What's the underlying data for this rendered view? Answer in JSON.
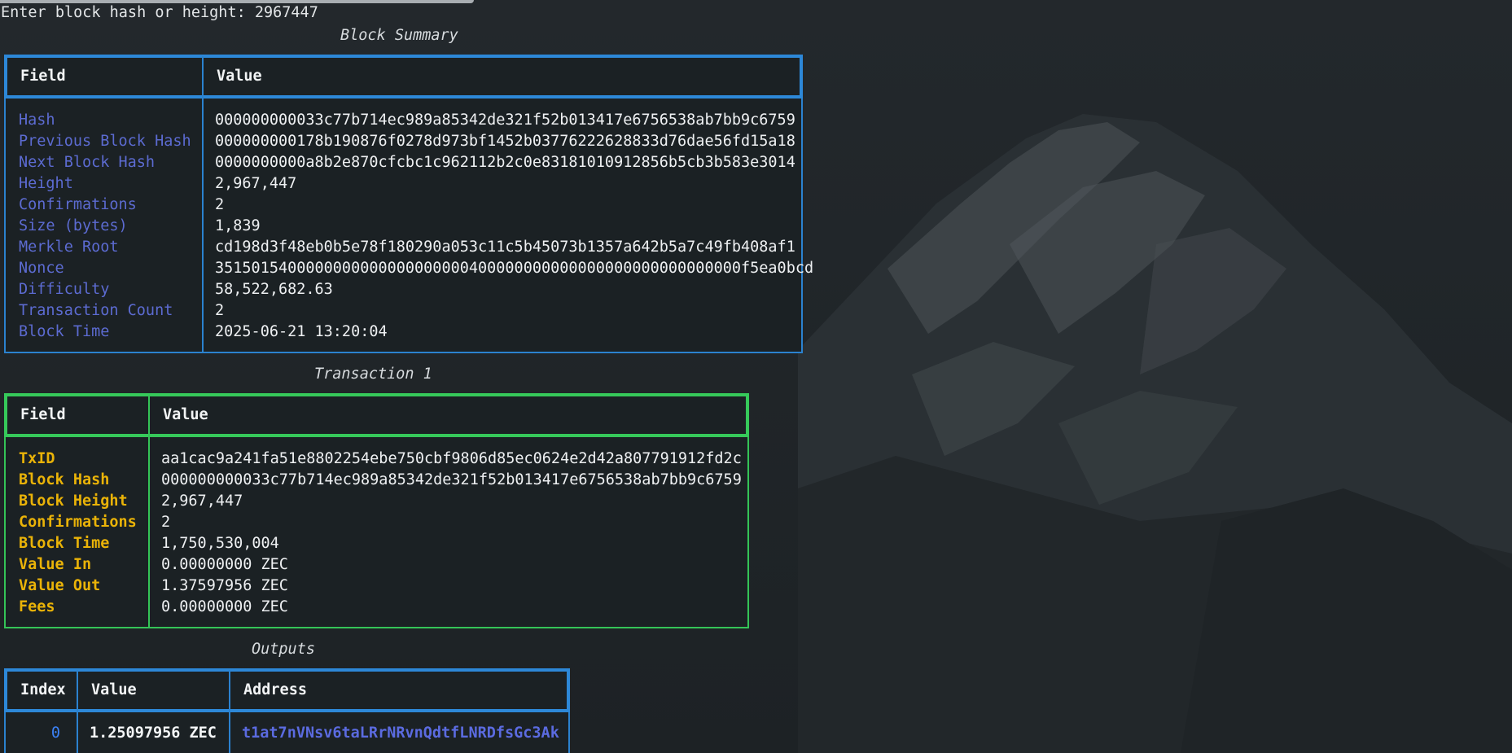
{
  "prompt": "Enter block hash or height: 2967447",
  "block_summary": {
    "caption": "Block Summary",
    "headers": [
      "Field",
      "Value"
    ],
    "rows": [
      {
        "field": "Hash",
        "value": "000000000033c77b714ec989a85342de321f52b013417e6756538ab7bb9c6759"
      },
      {
        "field": "Previous Block Hash",
        "value": "000000000178b190876f0278d973bf1452b03776222628833d76dae56fd15a18"
      },
      {
        "field": "Next Block Hash",
        "value": "0000000000a8b2e870cfcbc1c962112b2c0e83181010912856b5cb3b583e3014"
      },
      {
        "field": "Height",
        "value": "2,967,447"
      },
      {
        "field": "Confirmations",
        "value": "2"
      },
      {
        "field": "Size (bytes)",
        "value": "1,839"
      },
      {
        "field": "Merkle Root",
        "value": "cd198d3f48eb0b5e78f180290a053c11c5b45073b1357a642b5a7c49fb408af1"
      },
      {
        "field": "Nonce",
        "value": "3515015400000000000000000000400000000000000000000000000000f5ea0bcd"
      },
      {
        "field": "Difficulty",
        "value": "58,522,682.63"
      },
      {
        "field": "Transaction Count",
        "value": "2"
      },
      {
        "field": "Block Time",
        "value": "2025-06-21 13:20:04"
      }
    ]
  },
  "transaction": {
    "caption": "Transaction 1",
    "headers": [
      "Field",
      "Value"
    ],
    "rows": [
      {
        "field": "TxID",
        "value": "aa1cac9a241fa51e8802254ebe750cbf9806d85ec0624e2d42a807791912fd2c"
      },
      {
        "field": "Block Hash",
        "value": "000000000033c77b714ec989a85342de321f52b013417e6756538ab7bb9c6759"
      },
      {
        "field": "Block Height",
        "value": "2,967,447"
      },
      {
        "field": "Confirmations",
        "value": "2"
      },
      {
        "field": "Block Time",
        "value": "1,750,530,004"
      },
      {
        "field": "Value In",
        "value": "0.00000000 ZEC"
      },
      {
        "field": "Value Out",
        "value": "1.37597956 ZEC"
      },
      {
        "field": "Fees",
        "value": "0.00000000 ZEC"
      }
    ]
  },
  "outputs": {
    "caption": "Outputs",
    "headers": [
      "Index",
      "Value",
      "Address"
    ],
    "rows": [
      {
        "index": "0",
        "value": "1.25097956 ZEC",
        "address": "t1at7nVNsv6taLRrNRvnQdtfLNRDfsGc3Ak"
      }
    ]
  },
  "colors": {
    "block_border": "#2b82cf",
    "tx_border": "#34c457",
    "block_field_text": "#5c6bd1",
    "tx_field_text": "#eab308",
    "address_text": "#5b6be0"
  }
}
